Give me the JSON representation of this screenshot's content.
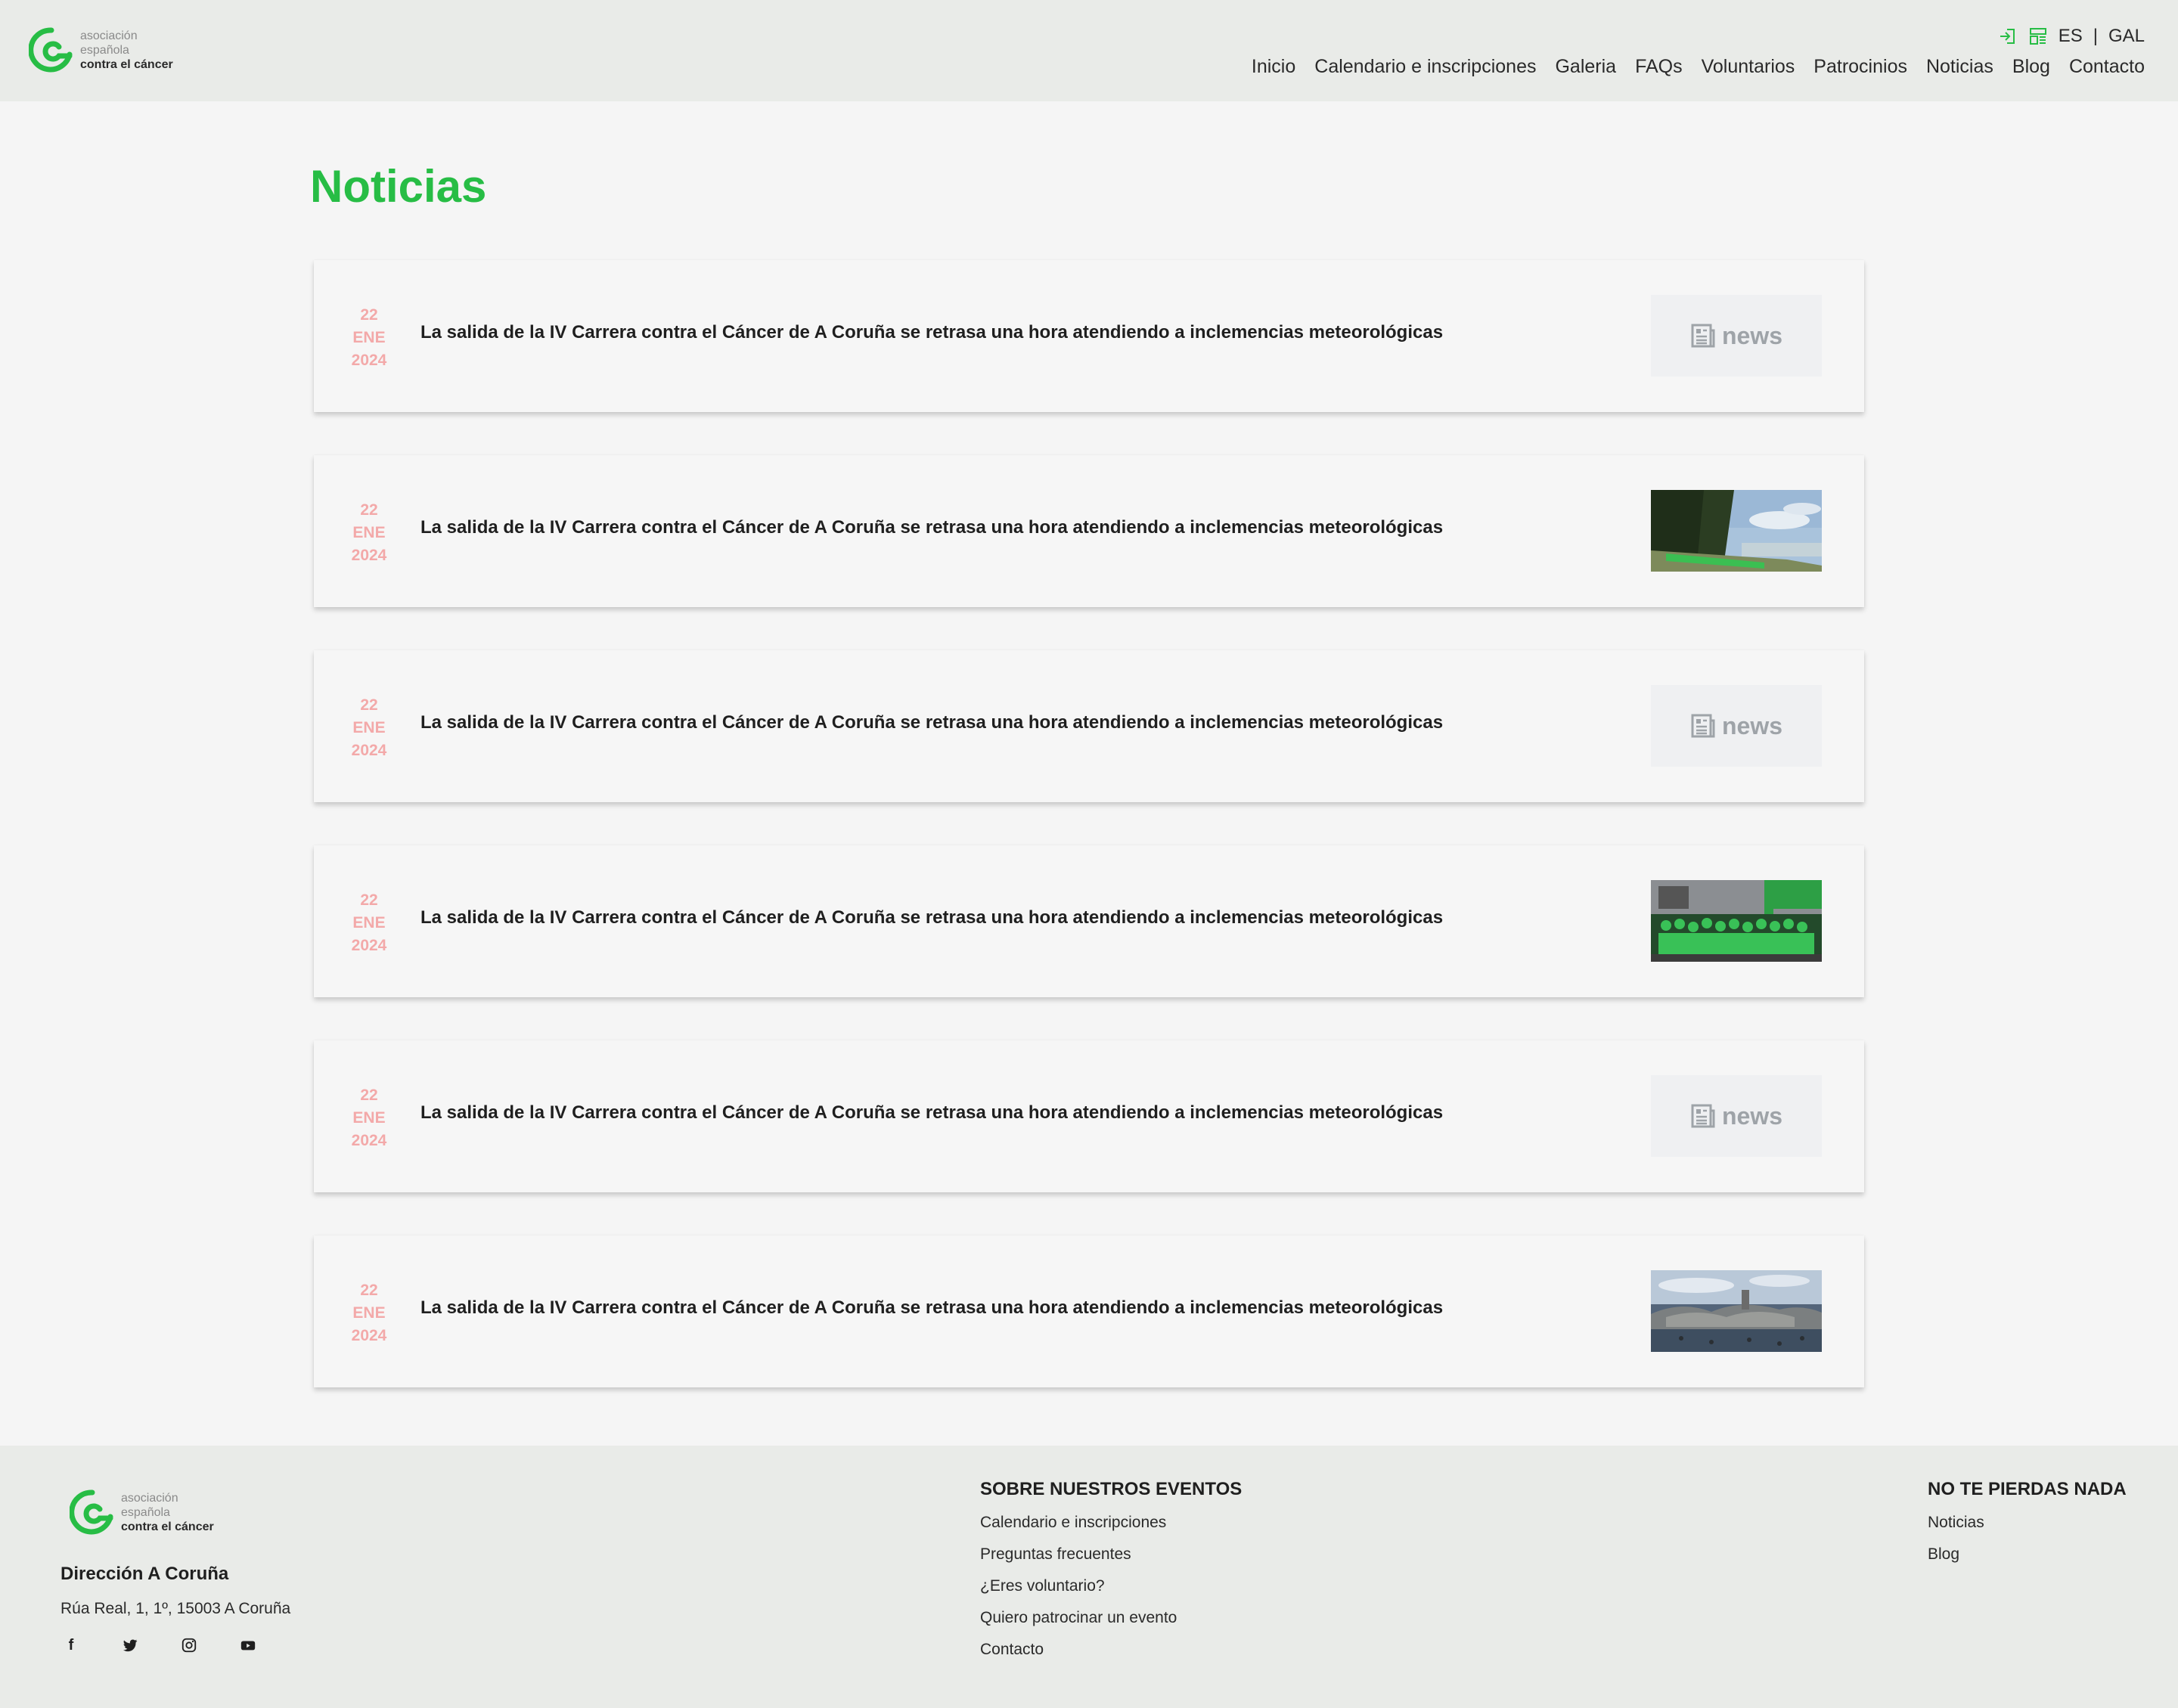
{
  "brand": {
    "line1": "asociación",
    "line2": "española",
    "line3": "contra el cáncer",
    "color": "#27bd45"
  },
  "header": {
    "languages": [
      "ES",
      "GAL"
    ],
    "separator": "|",
    "nav": [
      "Inicio",
      "Calendario e inscripciones",
      "Galeria",
      "FAQs",
      "Voluntarios",
      "Patrocinios",
      "Noticias",
      "Blog",
      "Contacto"
    ]
  },
  "main": {
    "title": "Noticias",
    "placeholder_label": "news",
    "news": [
      {
        "day": "22",
        "month": "ENE",
        "year": "2024",
        "title": "La salida de la IV Carrera contra el Cáncer de A Coruña se retrasa una hora atendiendo a inclemencias meteorológicas",
        "image": "placeholder"
      },
      {
        "day": "22",
        "month": "ENE",
        "year": "2024",
        "title": "La salida de la IV Carrera contra el Cáncer de A Coruña se retrasa una hora atendiendo a inclemencias meteorológicas",
        "image": "photo-coast-runners"
      },
      {
        "day": "22",
        "month": "ENE",
        "year": "2024",
        "title": "La salida de la IV Carrera contra el Cáncer de A Coruña se retrasa una hora atendiendo a inclemencias meteorológicas",
        "image": "placeholder"
      },
      {
        "day": "22",
        "month": "ENE",
        "year": "2024",
        "title": "La salida de la IV Carrera contra el Cáncer de A Coruña se retrasa una hora atendiendo a inclemencias meteorológicas",
        "image": "photo-group"
      },
      {
        "day": "22",
        "month": "ENE",
        "year": "2024",
        "title": "La salida de la IV Carrera contra el Cáncer de A Coruña se retrasa una hora atendiendo a inclemencias meteorológicas",
        "image": "placeholder"
      },
      {
        "day": "22",
        "month": "ENE",
        "year": "2024",
        "title": "La salida de la IV Carrera contra el Cáncer de A Coruña se retrasa una hora atendiendo a inclemencias meteorológicas",
        "image": "photo-rocks"
      }
    ],
    "date_color": "#f3a9a9"
  },
  "footer": {
    "office_title": "Dirección A Coruña",
    "address": "Rúa Real, 1, 1º, 15003 A Coruña",
    "social": [
      "facebook-icon",
      "twitter-icon",
      "instagram-icon",
      "youtube-icon"
    ],
    "events": {
      "heading": "SOBRE NUESTROS EVENTOS",
      "links": [
        "Calendario e inscripciones",
        "Preguntas frecuentes",
        "¿Eres voluntario?",
        "Quiero patrocinar un evento",
        "Contacto"
      ]
    },
    "more": {
      "heading": "NO TE PIERDAS NADA",
      "links": [
        "Noticias",
        "Blog"
      ]
    }
  }
}
